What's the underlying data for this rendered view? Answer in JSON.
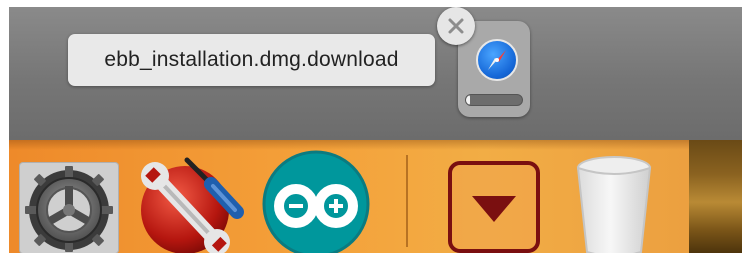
{
  "download": {
    "filename": "ebb_installation.dmg.download",
    "progress": 0.08,
    "app_icon": "safari-icon"
  },
  "dock": {
    "items": [
      {
        "name": "System Preferences",
        "icon": "gear-icon"
      },
      {
        "name": "Utility",
        "icon": "wrench-screwdriver-icon"
      },
      {
        "name": "Arduino",
        "icon": "arduino-icon"
      },
      {
        "name": "Downloads",
        "icon": "down-arrow-icon"
      },
      {
        "name": "Trash",
        "icon": "trash-icon"
      }
    ]
  },
  "colors": {
    "dock_orange": "#f29a33",
    "arduino_teal": "#00979c",
    "downloads_red": "#7a0f10"
  }
}
